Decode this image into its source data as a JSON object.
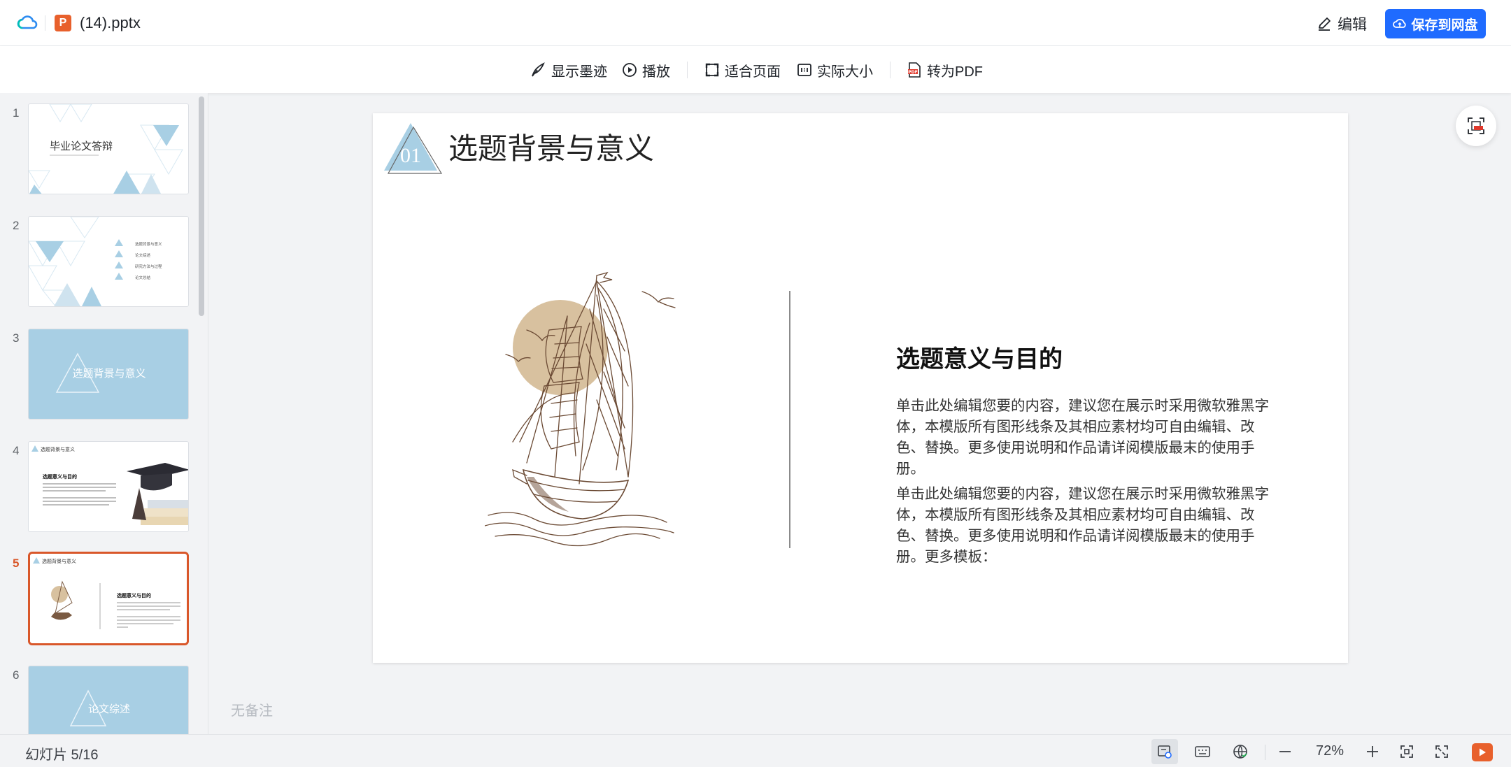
{
  "colors": {
    "accent": "#1f6bff",
    "active": "#d9572a",
    "slide_blue": "#a8cfe4",
    "sun": "#d8c19f"
  },
  "header": {
    "app_icon": "cloud-icon",
    "file_icon": "ppt-icon",
    "file_icon_letter": "P",
    "filename": "(14).pptx",
    "edit_label": "编辑",
    "save_label": "保存到网盘"
  },
  "toolbar": {
    "show_ink": "显示墨迹",
    "play": "播放",
    "fit_page": "适合页面",
    "actual_size": "实际大小",
    "to_pdf": "转为PDF"
  },
  "thumbnails": [
    {
      "num": "1",
      "title": "毕业论文答辩",
      "kind": "white"
    },
    {
      "num": "2",
      "title": "",
      "items": [
        "选题背景与意义",
        "论文综述",
        "研究方法与过程",
        "论文总结"
      ],
      "kind": "white"
    },
    {
      "num": "3",
      "title": "选题背景与意义",
      "kind": "blue"
    },
    {
      "num": "4",
      "title": "选题背景与意义",
      "sub": "选题意义与目的",
      "kind": "white"
    },
    {
      "num": "5",
      "title": "选题背景与意义",
      "sub": "选题意义与目的",
      "kind": "white",
      "active": true
    },
    {
      "num": "6",
      "title": "论文综述",
      "kind": "blue"
    }
  ],
  "slide": {
    "badge": "01",
    "title": "选题背景与意义",
    "subtitle": "选题意义与目的",
    "para1": "单击此处编辑您要的内容，建议您在展示时采用微软雅黑字体，本模版所有图形线条及其相应素材均可自由编辑、改色、替换。更多使用说明和作品请详阅模版最末的使用手册。",
    "para2": "单击此处编辑您要的内容，建议您在展示时采用微软雅黑字体，本模版所有图形线条及其相应素材均可自由编辑、改色、替换。更多使用说明和作品请详阅模版最末的使用手册。更多模板："
  },
  "notes": "无备注",
  "status": {
    "slide_count": "幻灯片 5/16",
    "zoom": "72%"
  }
}
